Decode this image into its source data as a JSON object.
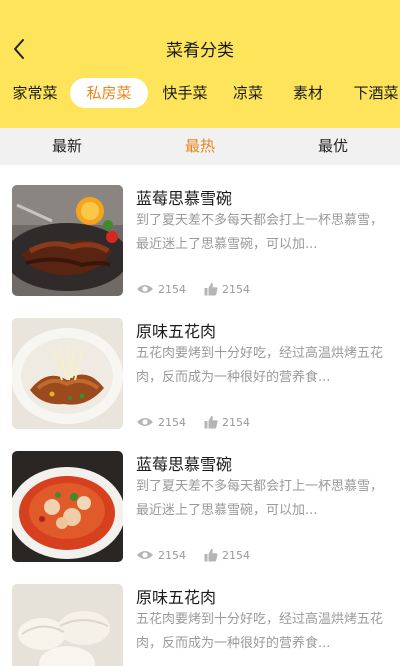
{
  "header": {
    "title": "菜肴分类"
  },
  "category_tabs": [
    {
      "label": "家常菜",
      "active": false
    },
    {
      "label": "私房菜",
      "active": true
    },
    {
      "label": "快手菜",
      "active": false
    },
    {
      "label": "凉菜",
      "active": false
    },
    {
      "label": "素材",
      "active": false
    },
    {
      "label": "下酒菜",
      "active": false
    }
  ],
  "sort_tabs": [
    {
      "label": "最新",
      "active": false
    },
    {
      "label": "最热",
      "active": true
    },
    {
      "label": "最优",
      "active": false
    }
  ],
  "colors": {
    "header_bg": "#fde45b",
    "accent": "#e8861a",
    "muted": "#9a9a9a"
  },
  "items": [
    {
      "title": "蓝莓思慕雪碗",
      "desc": "到了夏天差不多每天都会打上一杯思慕雪，最近迷上了思慕雪碗，可以加...",
      "views": "2154",
      "likes": "2154",
      "image": "grilled-ribs"
    },
    {
      "title": "原味五花肉",
      "desc": "五花肉要烤到十分好吃，经过高温烘烤五花肉，反而成为一种很好的营养食...",
      "views": "2154",
      "likes": "2154",
      "image": "pork-noodles"
    },
    {
      "title": "蓝莓思慕雪碗",
      "desc": "到了夏天差不多每天都会打上一杯思慕雪，最近迷上了思慕雪碗，可以加...",
      "views": "2154",
      "likes": "2154",
      "image": "spicy-soup"
    },
    {
      "title": "原味五花肉",
      "desc": "五花肉要烤到十分好吃，经过高温烘烤五花肉，反而成为一种很好的营养食...",
      "views": "2154",
      "likes": "2154",
      "image": "dumplings"
    }
  ]
}
